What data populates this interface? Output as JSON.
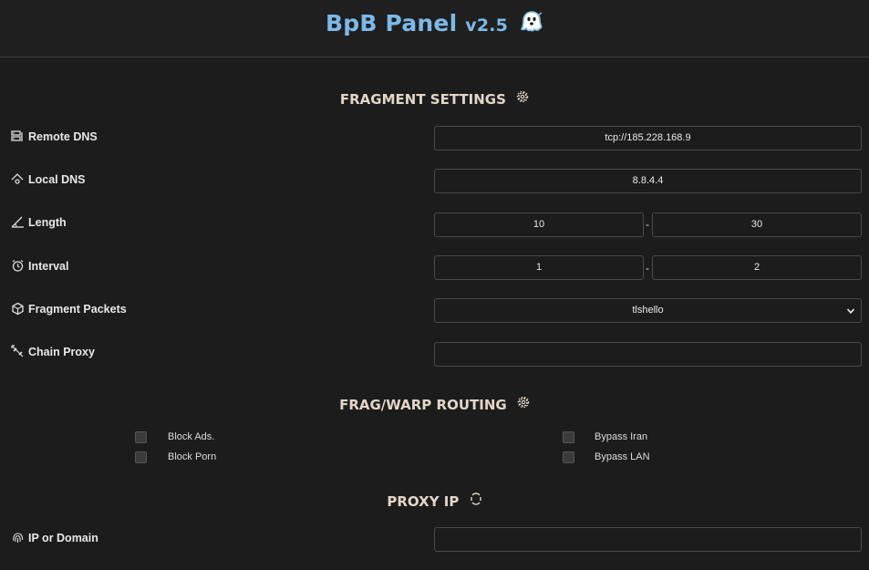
{
  "header": {
    "title": "BpB Panel",
    "version": "v2.5"
  },
  "fragment_settings": {
    "title": "FRAGMENT SETTINGS",
    "remote_dns": {
      "label": "Remote DNS",
      "value": "tcp://185.228.168.9"
    },
    "local_dns": {
      "label": "Local DNS",
      "value": "8.8.4.4"
    },
    "length": {
      "label": "Length",
      "min": "10",
      "max": "30"
    },
    "interval": {
      "label": "Interval",
      "min": "1",
      "max": "2"
    },
    "fragment_packets": {
      "label": "Fragment Packets",
      "selected": "tlshello"
    },
    "chain_proxy": {
      "label": "Chain Proxy",
      "value": ""
    },
    "separator": "-"
  },
  "routing": {
    "title": "FRAG/WARP ROUTING",
    "options": {
      "block_ads": {
        "label": "Block Ads.",
        "checked": false
      },
      "block_porn": {
        "label": "Block Porn",
        "checked": false
      },
      "bypass_iran": {
        "label": "Bypass Iran",
        "checked": false
      },
      "bypass_lan": {
        "label": "Bypass LAN",
        "checked": false
      }
    }
  },
  "proxy_ip": {
    "title": "PROXY IP",
    "ip_or_domain": {
      "label": "IP or Domain",
      "value": ""
    }
  },
  "colors": {
    "background": "#1c1c1c",
    "title_blue": "#7db9e8",
    "section_title": "#e2d6c9",
    "border": "#4a4a4a"
  }
}
